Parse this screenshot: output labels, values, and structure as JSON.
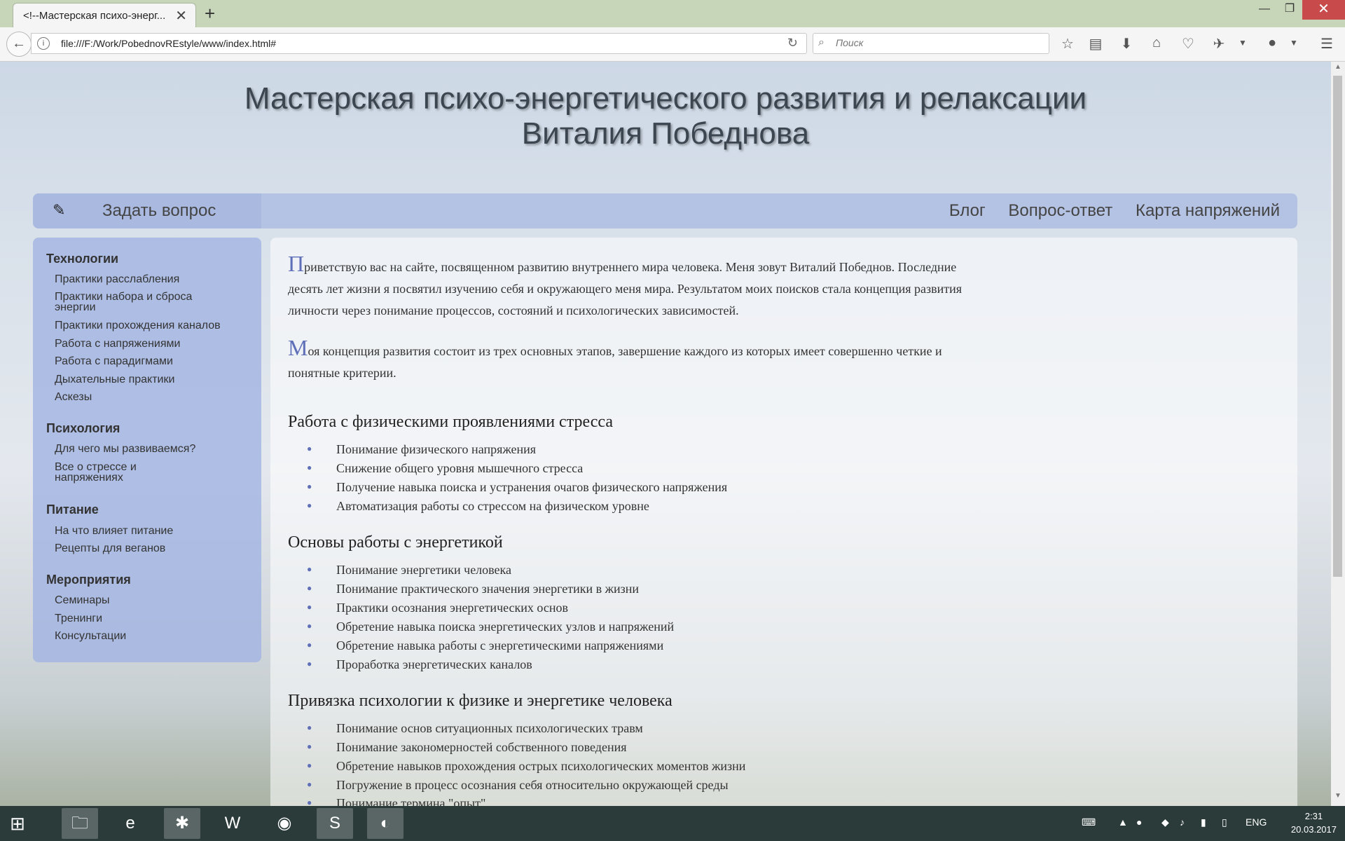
{
  "browser": {
    "tab_title": "<!--Мастерская психо-энерг...",
    "url": "file:///F:/Work/PobednovREstyle/www/index.html#",
    "search_placeholder": "Поиск"
  },
  "site": {
    "title_line1": "Мастерская психо-энергетического развития и релаксации",
    "title_line2": "Виталия Победнова"
  },
  "topnav": {
    "ask_label": "Задать вопрос",
    "links": [
      "Блог",
      "Вопрос-ответ",
      "Карта напряжений"
    ]
  },
  "sidebar": {
    "sections": [
      {
        "title": "Технологии",
        "items": [
          "Практики расслабления",
          "Практики набора и сброса энергии",
          "Практики прохождения каналов",
          "Работа с напряжениями",
          "Работа с парадигмами",
          "Дыхательные практики",
          "Аскезы"
        ]
      },
      {
        "title": "Психология",
        "items": [
          "Для чего мы развиваемся?",
          "Все о стрессе и напряжениях"
        ]
      },
      {
        "title": "Питание",
        "items": [
          "На что влияет питание",
          "Рецепты для веганов"
        ]
      },
      {
        "title": "Мероприятия",
        "items": [
          "Семинары",
          "Тренинги",
          "Консультации"
        ]
      }
    ]
  },
  "content": {
    "para1_cap": "П",
    "para1": "риветствую вас на сайте, посвященном развитию внутреннего мира человека. Меня зовут Виталий Победнов. Последние десять лет жизни я посвятил изучению себя и окружающего меня мира. Результатом моих поисков стала концепция развития личности через понимание процессов, состояний и психологических зависимостей.",
    "para2_cap": "М",
    "para2": "оя концепция развития состоит из трех основных этапов, завершение каждого из которых имеет совершенно четкие и понятные критерии.",
    "sections": [
      {
        "title": "Работа с физическими проявлениями стресса",
        "items": [
          "Понимание физического напряжения",
          "Снижение общего уровня мышечного стресса",
          "Получение навыка поиска и устранения очагов физического напряжения",
          "Автоматизация работы со стрессом на физическом уровне"
        ]
      },
      {
        "title": "Основы работы с энергетикой",
        "items": [
          "Понимание энергетики человека",
          "Понимание практического значения энергетики в жизни",
          "Практики осознания энергетических основ",
          "Обретение навыка поиска энергетических узлов и напряжений",
          "Обретение навыка работы с энергетическими напряжениями",
          "Проработка энергетических каналов"
        ]
      },
      {
        "title": "Привязка психологии к физике и энергетике человека",
        "items": [
          "Понимание основ ситуационных психологических травм",
          "Понимание закономерностей собственного поведения",
          "Обретение навыков прохождения острых психологических моментов жизни",
          "Погружение в процесс осознания себя относительно окружающей среды",
          "Понимание термина \"опыт\""
        ]
      }
    ]
  },
  "taskbar": {
    "lang": "ENG",
    "time": "2:31",
    "date": "20.03.2017"
  }
}
